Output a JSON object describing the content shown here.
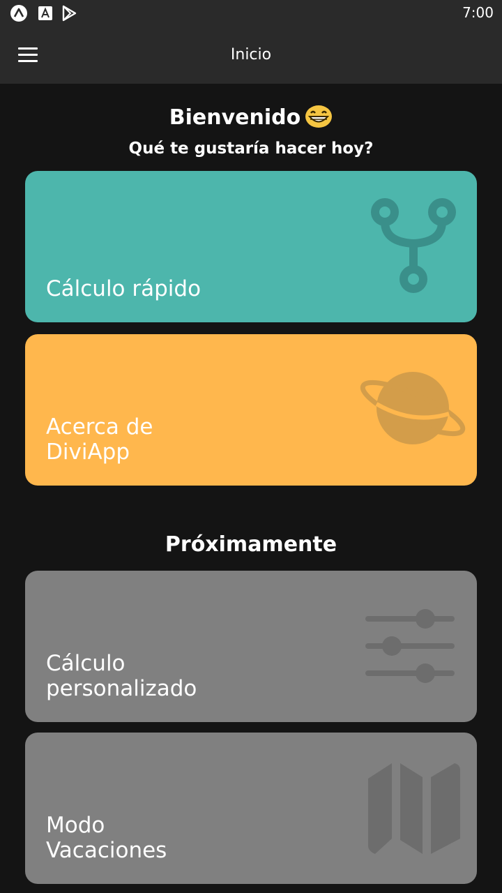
{
  "status_bar": {
    "time": "7:00",
    "icons": [
      "expo-icon",
      "app-store-icon",
      "play-store-icon"
    ]
  },
  "app_bar": {
    "title": "Inicio",
    "menu_icon": "hamburger-menu-icon"
  },
  "header": {
    "welcome": "Bienvenido",
    "emoji": "grinning-face-icon",
    "question": "Qué te gustaría hacer hoy?"
  },
  "cards": [
    {
      "label": "Cálculo rápido",
      "icon": "fork-icon",
      "color": "#4db6ac"
    },
    {
      "label": "Acerca de\nDiviApp",
      "icon": "planet-icon",
      "color": "#ffb74d"
    }
  ],
  "upcoming": {
    "title": "Próximamente",
    "cards": [
      {
        "label": "Cálculo\npersonalizado",
        "icon": "sliders-icon",
        "color": "#808080"
      },
      {
        "label": "Modo\nVacaciones",
        "icon": "map-icon",
        "color": "#808080"
      }
    ]
  }
}
